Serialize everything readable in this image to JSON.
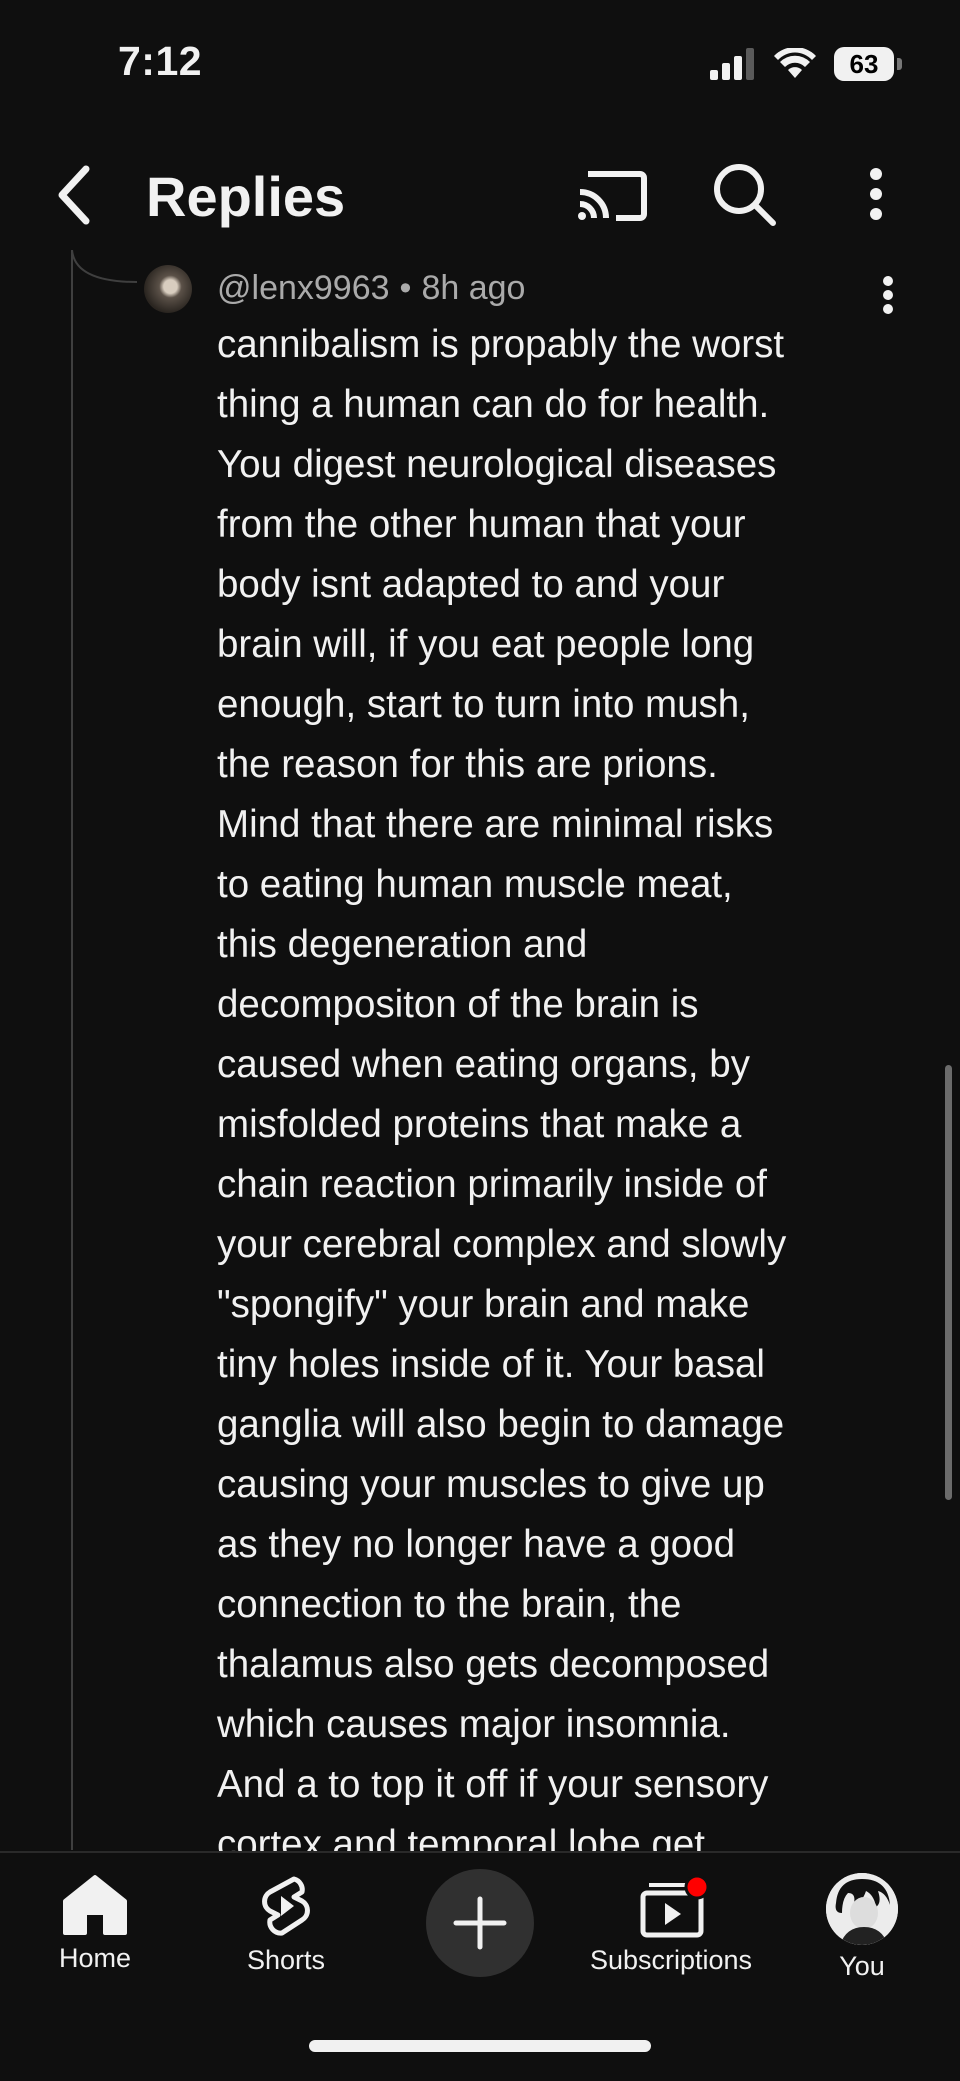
{
  "status_bar": {
    "time": "7:12",
    "battery": "63"
  },
  "header": {
    "title": "Replies",
    "back_icon": "chevron-left-icon",
    "cast_icon": "cast-icon",
    "search_icon": "search-icon",
    "more_icon": "more-vertical-icon"
  },
  "comment": {
    "author": "@lenx9963",
    "separator": "•",
    "time_ago": "8h ago",
    "text": "cannibalism is propably the worst\nthing a human can do for health.\nYou digest neurological diseases\nfrom the other human that your\nbody isnt adapted to and your\nbrain will, if you eat people long\nenough, start to turn into mush,\nthe reason for this are prions.\nMind that there are minimal risks\nto eating human muscle meat,\nthis degeneration and\ndecompositon of the brain is\ncaused when eating organs, by\nmisfolded proteins that make a\nchain reaction primarily inside of\nyour cerebral complex and slowly\n\"spongify\" your brain and make\ntiny holes inside of it. Your basal\nganglia will also begin to damage\ncausing your muscles to give up\nas they no longer have a good\nconnection to the brain, the\nthalamus also gets decomposed\nwhich causes major insomnia.\nAnd a to top it off if your sensory\ncortex and temporal lobe get"
  },
  "bottom_nav": {
    "home": "Home",
    "shorts": "Shorts",
    "create_icon": "plus-icon",
    "subscriptions": "Subscriptions",
    "you": "You",
    "notification_color": "#ff0000"
  }
}
